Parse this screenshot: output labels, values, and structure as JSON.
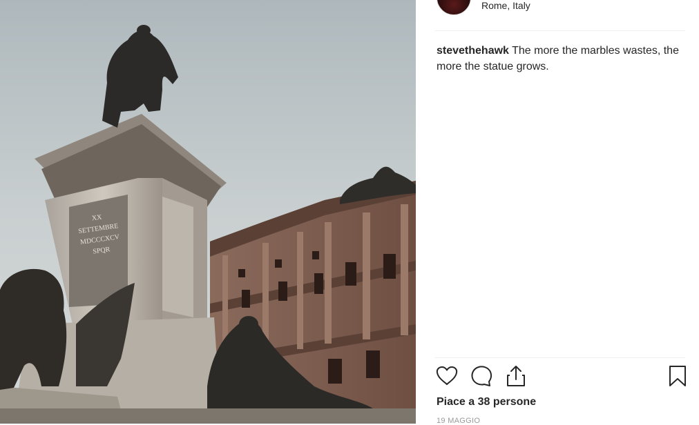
{
  "post": {
    "location": "Rome, Italy",
    "caption_user": "stevethehawk",
    "caption_text": "The more the marbles wastes, the more the statue grows.",
    "likes_text": "Piace a 38 persone",
    "date_text": "19 MAGGIO"
  },
  "photo": {
    "inscription": [
      "XX",
      "SETTEMBRE",
      "MDCCCXCV",
      "SPQR"
    ]
  },
  "icons": {
    "like": "heart-icon",
    "comment": "comment-bubble-icon",
    "share": "share-upload-icon",
    "save": "bookmark-icon"
  },
  "colors": {
    "text": "#262626",
    "muted": "#999999",
    "divider": "#efefef"
  }
}
